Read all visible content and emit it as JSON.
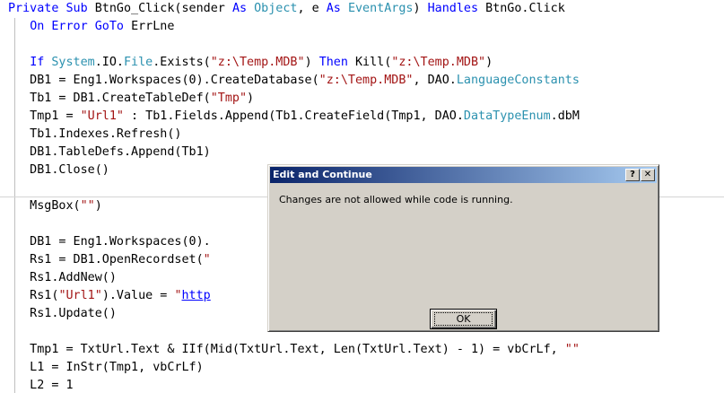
{
  "code": {
    "lines": [
      [
        [
          "kw",
          "Private Sub "
        ],
        [
          "",
          "BtnGo_Click(sender "
        ],
        [
          "kw",
          "As "
        ],
        [
          "typ",
          "Object"
        ],
        [
          "",
          ", e "
        ],
        [
          "kw",
          "As "
        ],
        [
          "typ",
          "EventArgs"
        ],
        [
          "",
          ") "
        ],
        [
          "kw",
          "Handles "
        ],
        [
          "",
          "BtnGo.Click"
        ]
      ],
      [
        [
          "",
          "   "
        ],
        [
          "kw",
          "On Error GoTo "
        ],
        [
          "",
          "ErrLne"
        ]
      ],
      [
        [
          "",
          ""
        ]
      ],
      [
        [
          "",
          "   "
        ],
        [
          "kw",
          "If "
        ],
        [
          "typ",
          "System"
        ],
        [
          "",
          ".IO."
        ],
        [
          "typ",
          "File"
        ],
        [
          "",
          ".Exists("
        ],
        [
          "str",
          "\"z:\\Temp.MDB\""
        ],
        [
          "",
          ") "
        ],
        [
          "kw",
          "Then "
        ],
        [
          "",
          "Kill("
        ],
        [
          "str",
          "\"z:\\Temp.MDB\""
        ],
        [
          "",
          ")"
        ]
      ],
      [
        [
          "",
          "   DB1 = Eng1.Workspaces(0).CreateDatabase("
        ],
        [
          "str",
          "\"z:\\Temp.MDB\""
        ],
        [
          "",
          ", DAO."
        ],
        [
          "typ",
          "LanguageConstants"
        ]
      ],
      [
        [
          "",
          "   Tb1 = DB1.CreateTableDef("
        ],
        [
          "str",
          "\"Tmp\""
        ],
        [
          "",
          ")"
        ]
      ],
      [
        [
          "",
          "   Tmp1 = "
        ],
        [
          "str",
          "\"Url1\""
        ],
        [
          "",
          " : Tb1.Fields.Append(Tb1.CreateField(Tmp1, DAO."
        ],
        [
          "typ",
          "DataTypeEnum"
        ],
        [
          "",
          ".dbM"
        ]
      ],
      [
        [
          "",
          "   Tb1.Indexes.Refresh()"
        ]
      ],
      [
        [
          "",
          "   DB1.TableDefs.Append(Tb1)"
        ]
      ],
      [
        [
          "",
          "   DB1.Close()"
        ]
      ],
      [
        [
          "",
          ""
        ]
      ],
      [
        [
          "",
          "   MsgBox("
        ],
        [
          "str",
          "\"\""
        ],
        [
          "",
          ")"
        ]
      ],
      [
        [
          "",
          ""
        ]
      ],
      [
        [
          "",
          "   DB1 = Eng1.Workspaces(0)."
        ]
      ],
      [
        [
          "",
          "   Rs1 = DB1.OpenRecordset("
        ],
        [
          "str",
          "\""
        ]
      ],
      [
        [
          "",
          "   Rs1.AddNew()"
        ]
      ],
      [
        [
          "",
          "   Rs1("
        ],
        [
          "str",
          "\"Url1\""
        ],
        [
          "",
          ").Value = "
        ],
        [
          "str",
          "\""
        ],
        [
          "url",
          "http"
        ]
      ],
      [
        [
          "",
          "   Rs1.Update()"
        ]
      ],
      [
        [
          "",
          ""
        ]
      ],
      [
        [
          "",
          "   Tmp1 = TxtUrl.Text & IIf(Mid(TxtUrl.Text, Len(TxtUrl.Text) - 1) = vbCrLf, "
        ],
        [
          "str",
          "\"\""
        ]
      ],
      [
        [
          "",
          "   L1 = InStr(Tmp1, vbCrLf)"
        ]
      ],
      [
        [
          "",
          "   L2 = 1"
        ]
      ]
    ]
  },
  "dialog": {
    "title": "Edit and Continue",
    "message": "Changes are not allowed while code is running.",
    "ok_label": "OK",
    "help_glyph": "?",
    "close_glyph": "✕"
  },
  "colors": {
    "keyword": "#0000ff",
    "string": "#a31515",
    "type": "#2b91af",
    "titlebar_start": "#0a246a",
    "titlebar_end": "#a6caf0",
    "dialog_face": "#d4d0c8"
  }
}
